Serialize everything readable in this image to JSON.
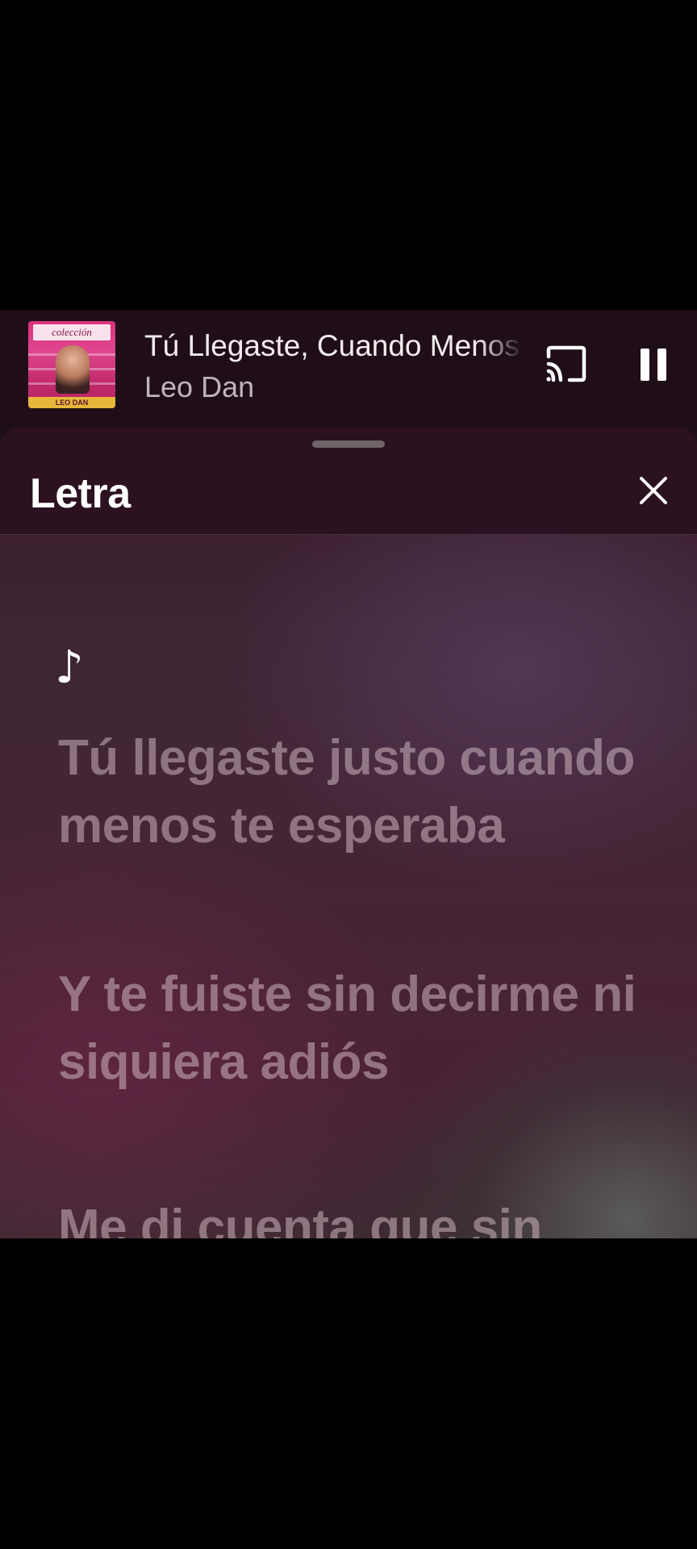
{
  "mini_player": {
    "title": "Tú Llegaste, Cuando Menos Te Esperaba",
    "artist": "Leo Dan",
    "album_art": {
      "badge_text": "colección",
      "band_text": "LEO DAN"
    },
    "cast_icon": "cast-icon",
    "pause_icon": "pause-icon"
  },
  "lyrics_sheet": {
    "title": "Letra",
    "close_icon": "close-icon",
    "note_glyph": "♪",
    "lines": [
      "Tú llegaste justo cuando menos te esperaba",
      "Y te fuiste sin decirme ni siquiera adiós",
      "Me di cuenta que sin"
    ]
  },
  "colors": {
    "player_background": "#1f0e18",
    "sheet_header_background": "#2c1121",
    "lyric_text": "#cdb4c0"
  }
}
